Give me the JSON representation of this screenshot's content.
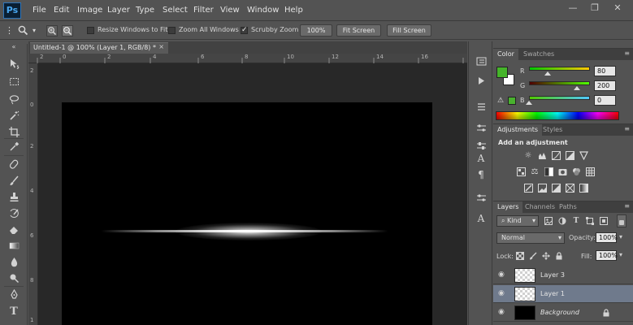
{
  "app": {
    "logo": "Ps"
  },
  "menu": [
    "File",
    "Edit",
    "Image",
    "Layer",
    "Type",
    "Select",
    "Filter",
    "View",
    "Window",
    "Help"
  ],
  "window_controls": {
    "minimize": "—",
    "restore": "❐",
    "close": "✕"
  },
  "options_bar": {
    "tool_icon": "zoom-icon",
    "zoom_in_icon": "zoom-in-icon",
    "zoom_out_icon": "zoom-out-icon",
    "resize_windows_label": "Resize Windows to Fit",
    "resize_windows_checked": false,
    "zoom_all_label": "Zoom All Windows",
    "zoom_all_checked": false,
    "scrubby_label": "Scrubby Zoom",
    "scrubby_checked": true,
    "btn_100": "100%",
    "btn_fit": "Fit Screen",
    "btn_fill": "Fill Screen"
  },
  "document": {
    "tab_title": "Untitled-1 @ 100% (Layer 1, RGB/8) *",
    "close_glyph": "×",
    "ruler_h": [
      "2",
      "0",
      "2",
      "4",
      "6",
      "8",
      "10",
      "12",
      "14",
      "16"
    ],
    "ruler_v": [
      "2",
      "0",
      "2",
      "4",
      "6",
      "8",
      "1"
    ]
  },
  "color_panel": {
    "tabs": [
      "Color",
      "Swatches"
    ],
    "foreground": "#45b42a",
    "background": "#ffffff",
    "channels": [
      {
        "label": "R",
        "value": "80",
        "level": 0.31
      },
      {
        "label": "G",
        "value": "200",
        "level": 0.78
      },
      {
        "label": "B",
        "value": "0",
        "level": 0.0
      }
    ]
  },
  "adjustments_panel": {
    "tabs": [
      "Adjustments",
      "Styles"
    ],
    "heading": "Add an adjustment"
  },
  "layers_panel": {
    "tabs": [
      "Layers",
      "Channels",
      "Paths"
    ],
    "filter_kind": "Kind",
    "blend_mode": "Normal",
    "opacity_label": "Opacity:",
    "opacity_value": "100%",
    "lock_label": "Lock:",
    "fill_label": "Fill:",
    "fill_value": "100%",
    "layers": [
      {
        "name": "Layer 3",
        "selected": false
      },
      {
        "name": "Layer 1",
        "selected": true
      },
      {
        "name": "Background",
        "selected": false
      }
    ]
  },
  "glyphs": {
    "chevron_down": "▾",
    "eye": "◉",
    "lock": "🔒",
    "check": "✓",
    "warn": "⚠",
    "panel_menu": "≡",
    "collapse": "«",
    "toggle": "▸"
  }
}
